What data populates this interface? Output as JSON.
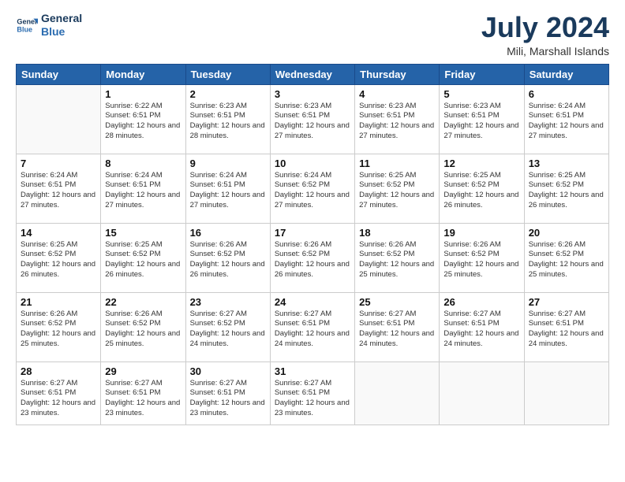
{
  "logo": {
    "line1": "General",
    "line2": "Blue"
  },
  "title": "July 2024",
  "location": "Mili, Marshall Islands",
  "days": [
    "Sunday",
    "Monday",
    "Tuesday",
    "Wednesday",
    "Thursday",
    "Friday",
    "Saturday"
  ],
  "weeks": [
    [
      {
        "day": "",
        "info": ""
      },
      {
        "day": "1",
        "info": "Sunrise: 6:22 AM\nSunset: 6:51 PM\nDaylight: 12 hours\nand 28 minutes."
      },
      {
        "day": "2",
        "info": "Sunrise: 6:23 AM\nSunset: 6:51 PM\nDaylight: 12 hours\nand 28 minutes."
      },
      {
        "day": "3",
        "info": "Sunrise: 6:23 AM\nSunset: 6:51 PM\nDaylight: 12 hours\nand 27 minutes."
      },
      {
        "day": "4",
        "info": "Sunrise: 6:23 AM\nSunset: 6:51 PM\nDaylight: 12 hours\nand 27 minutes."
      },
      {
        "day": "5",
        "info": "Sunrise: 6:23 AM\nSunset: 6:51 PM\nDaylight: 12 hours\nand 27 minutes."
      },
      {
        "day": "6",
        "info": "Sunrise: 6:24 AM\nSunset: 6:51 PM\nDaylight: 12 hours\nand 27 minutes."
      }
    ],
    [
      {
        "day": "7",
        "info": "Sunrise: 6:24 AM\nSunset: 6:51 PM\nDaylight: 12 hours\nand 27 minutes."
      },
      {
        "day": "8",
        "info": "Sunrise: 6:24 AM\nSunset: 6:51 PM\nDaylight: 12 hours\nand 27 minutes."
      },
      {
        "day": "9",
        "info": "Sunrise: 6:24 AM\nSunset: 6:51 PM\nDaylight: 12 hours\nand 27 minutes."
      },
      {
        "day": "10",
        "info": "Sunrise: 6:24 AM\nSunset: 6:52 PM\nDaylight: 12 hours\nand 27 minutes."
      },
      {
        "day": "11",
        "info": "Sunrise: 6:25 AM\nSunset: 6:52 PM\nDaylight: 12 hours\nand 27 minutes."
      },
      {
        "day": "12",
        "info": "Sunrise: 6:25 AM\nSunset: 6:52 PM\nDaylight: 12 hours\nand 26 minutes."
      },
      {
        "day": "13",
        "info": "Sunrise: 6:25 AM\nSunset: 6:52 PM\nDaylight: 12 hours\nand 26 minutes."
      }
    ],
    [
      {
        "day": "14",
        "info": "Sunrise: 6:25 AM\nSunset: 6:52 PM\nDaylight: 12 hours\nand 26 minutes."
      },
      {
        "day": "15",
        "info": "Sunrise: 6:25 AM\nSunset: 6:52 PM\nDaylight: 12 hours\nand 26 minutes."
      },
      {
        "day": "16",
        "info": "Sunrise: 6:26 AM\nSunset: 6:52 PM\nDaylight: 12 hours\nand 26 minutes."
      },
      {
        "day": "17",
        "info": "Sunrise: 6:26 AM\nSunset: 6:52 PM\nDaylight: 12 hours\nand 26 minutes."
      },
      {
        "day": "18",
        "info": "Sunrise: 6:26 AM\nSunset: 6:52 PM\nDaylight: 12 hours\nand 25 minutes."
      },
      {
        "day": "19",
        "info": "Sunrise: 6:26 AM\nSunset: 6:52 PM\nDaylight: 12 hours\nand 25 minutes."
      },
      {
        "day": "20",
        "info": "Sunrise: 6:26 AM\nSunset: 6:52 PM\nDaylight: 12 hours\nand 25 minutes."
      }
    ],
    [
      {
        "day": "21",
        "info": "Sunrise: 6:26 AM\nSunset: 6:52 PM\nDaylight: 12 hours\nand 25 minutes."
      },
      {
        "day": "22",
        "info": "Sunrise: 6:26 AM\nSunset: 6:52 PM\nDaylight: 12 hours\nand 25 minutes."
      },
      {
        "day": "23",
        "info": "Sunrise: 6:27 AM\nSunset: 6:52 PM\nDaylight: 12 hours\nand 24 minutes."
      },
      {
        "day": "24",
        "info": "Sunrise: 6:27 AM\nSunset: 6:51 PM\nDaylight: 12 hours\nand 24 minutes."
      },
      {
        "day": "25",
        "info": "Sunrise: 6:27 AM\nSunset: 6:51 PM\nDaylight: 12 hours\nand 24 minutes."
      },
      {
        "day": "26",
        "info": "Sunrise: 6:27 AM\nSunset: 6:51 PM\nDaylight: 12 hours\nand 24 minutes."
      },
      {
        "day": "27",
        "info": "Sunrise: 6:27 AM\nSunset: 6:51 PM\nDaylight: 12 hours\nand 24 minutes."
      }
    ],
    [
      {
        "day": "28",
        "info": "Sunrise: 6:27 AM\nSunset: 6:51 PM\nDaylight: 12 hours\nand 23 minutes."
      },
      {
        "day": "29",
        "info": "Sunrise: 6:27 AM\nSunset: 6:51 PM\nDaylight: 12 hours\nand 23 minutes."
      },
      {
        "day": "30",
        "info": "Sunrise: 6:27 AM\nSunset: 6:51 PM\nDaylight: 12 hours\nand 23 minutes."
      },
      {
        "day": "31",
        "info": "Sunrise: 6:27 AM\nSunset: 6:51 PM\nDaylight: 12 hours\nand 23 minutes."
      },
      {
        "day": "",
        "info": ""
      },
      {
        "day": "",
        "info": ""
      },
      {
        "day": "",
        "info": ""
      }
    ]
  ]
}
